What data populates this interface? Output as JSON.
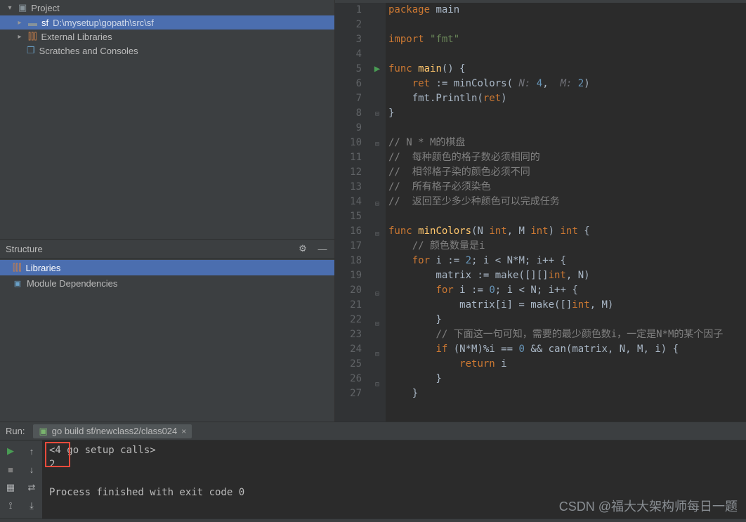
{
  "project": {
    "root_label": "Project",
    "items": [
      {
        "name": "sf",
        "path": "D:\\mysetup\\gopath\\src\\sf"
      },
      {
        "name": "External Libraries"
      },
      {
        "name": "Scratches and Consoles"
      }
    ]
  },
  "structure": {
    "title": "Structure",
    "items": [
      {
        "label": "Libraries"
      },
      {
        "label": "Module Dependencies"
      }
    ]
  },
  "editor": {
    "lines": [
      {
        "n": 1,
        "html": "<span class='kw'>package</span> main"
      },
      {
        "n": 2,
        "html": ""
      },
      {
        "n": 3,
        "html": "<span class='kw'>import</span> <span class='str'>\"fmt\"</span>"
      },
      {
        "n": 4,
        "html": ""
      },
      {
        "n": 5,
        "html": "<span class='kw'>func</span> <span class='fn'>main</span>() {",
        "run": true,
        "fold": "⊟"
      },
      {
        "n": 6,
        "html": "    <span class='kw'>ret</span> := minColors( <span class='param'>N:</span> <span class='num'>4</span>,  <span class='param'>M:</span> <span class='num'>2</span>)"
      },
      {
        "n": 7,
        "html": "    fmt.Println(<span class='kw'>ret</span>)"
      },
      {
        "n": 8,
        "html": "}",
        "fold": "⊟"
      },
      {
        "n": 9,
        "html": ""
      },
      {
        "n": 10,
        "html": "<span class='comment'>// N * M的棋盘</span>",
        "fold": "⊟"
      },
      {
        "n": 11,
        "html": "<span class='comment'>//  每种颜色的格子数必须相同的</span>"
      },
      {
        "n": 12,
        "html": "<span class='comment'>//  相邻格子染的颜色必须不同</span>"
      },
      {
        "n": 13,
        "html": "<span class='comment'>//  所有格子必须染色</span>"
      },
      {
        "n": 14,
        "html": "<span class='comment'>//  返回至少多少种颜色可以完成任务</span>",
        "fold": "⊟"
      },
      {
        "n": 15,
        "html": ""
      },
      {
        "n": 16,
        "html": "<span class='kw'>func</span> <span class='fn'>minColors</span>(N <span class='type'>int</span>, M <span class='type'>int</span>) <span class='type'>int</span> {",
        "fold": "⊟"
      },
      {
        "n": 17,
        "html": "    <span class='comment'>// 颜色数量是i</span>"
      },
      {
        "n": 18,
        "html": "    <span class='kw'>for</span> i := <span class='num'>2</span>; i &lt; N*M; i++ {"
      },
      {
        "n": 19,
        "html": "        matrix := make([][]<span class='type'>int</span>, N)"
      },
      {
        "n": 20,
        "html": "        <span class='kw'>for</span> i := <span class='num'>0</span>; i &lt; N; i++ {",
        "fold": "⊟"
      },
      {
        "n": 21,
        "html": "            matrix[i] = make([]<span class='type'>int</span>, M)"
      },
      {
        "n": 22,
        "html": "        }",
        "fold": "⊟"
      },
      {
        "n": 23,
        "html": "        <span class='comment'>// 下面这一句可知，需要的最少颜色数i，一定是N*M的某个因子</span>"
      },
      {
        "n": 24,
        "html": "        <span class='kw'>if</span> (N*M)%i == <span class='num'>0</span> &amp;&amp; can(matrix, N, M, i) {",
        "fold": "⊟"
      },
      {
        "n": 25,
        "html": "            <span class='kw'>return</span> i"
      },
      {
        "n": 26,
        "html": "        }",
        "fold": "⊟"
      },
      {
        "n": 27,
        "html": "    }"
      }
    ]
  },
  "run": {
    "label": "Run:",
    "tab": "go build sf/newclass2/class024",
    "lines": [
      "<4 go setup calls>",
      "2",
      "",
      "Process finished with exit code 0"
    ]
  },
  "watermark": "CSDN @福大大架构师每日一题"
}
